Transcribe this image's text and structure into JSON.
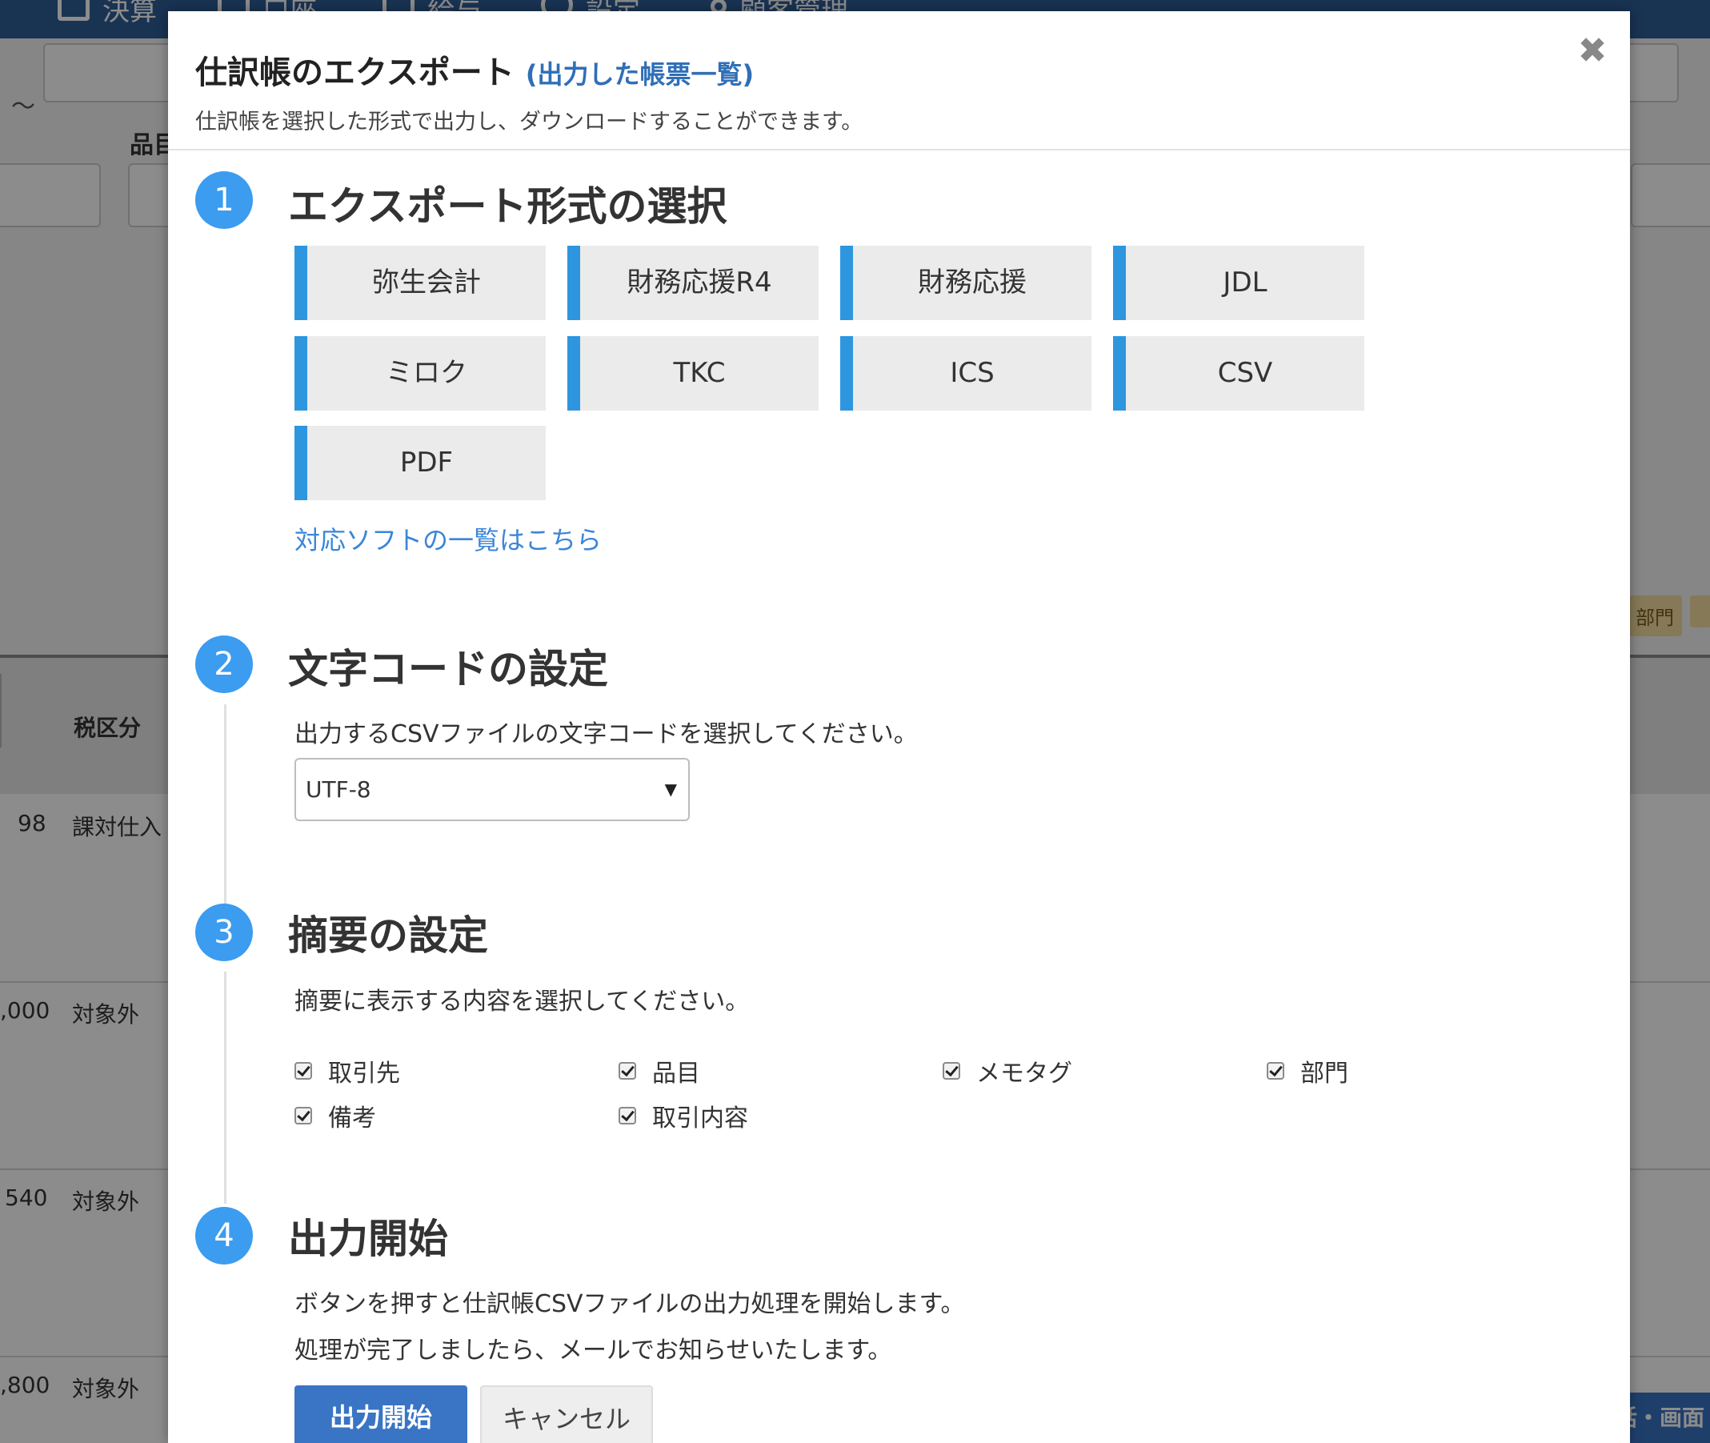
{
  "background": {
    "nav": [
      "決算",
      "口座",
      "給与",
      "設定",
      "顧客管理"
    ],
    "tilde": "〜",
    "field_label": "品目",
    "table_header": "税区分",
    "rows": [
      {
        "amount": "98",
        "tax": "課対仕入"
      },
      {
        "amount": ",000",
        "tax": "対象外"
      },
      {
        "amount": "540",
        "tax": "対象外"
      },
      {
        "amount": ",800",
        "tax": "対象外"
      }
    ],
    "tag": "部門",
    "help_text": "話・画面"
  },
  "modal": {
    "title": "仕訳帳のエクスポート",
    "title_link": "(出力した帳票一覧)",
    "description": "仕訳帳を選択した形式で出力し、ダウンロードすることができます。",
    "close_glyph": "✖"
  },
  "steps": {
    "s1": {
      "number": "1",
      "title": "エクスポート形式の選択",
      "formats": [
        "弥生会計",
        "財務応援R4",
        "財務応援",
        "JDL",
        "ミロク",
        "TKC",
        "ICS",
        "CSV",
        "PDF"
      ],
      "link": "対応ソフトの一覧はこちら"
    },
    "s2": {
      "number": "2",
      "title": "文字コードの設定",
      "text": "出力するCSVファイルの文字コードを選択してください。",
      "select_value": "UTF-8"
    },
    "s3": {
      "number": "3",
      "title": "摘要の設定",
      "text": "摘要に表示する内容を選択してください。",
      "checkboxes": [
        "取引先",
        "品目",
        "メモタグ",
        "部門",
        "備考",
        "取引内容"
      ]
    },
    "s4": {
      "number": "4",
      "title": "出力開始",
      "text1": "ボタンを押すと仕訳帳CSVファイルの出力処理を開始します。",
      "text2": "処理が完了しましたら、メールでお知らせいたします。",
      "start_button": "出力開始",
      "cancel_button": "キャンセル"
    }
  },
  "colors": {
    "accent_blue": "#2d96df",
    "step_circle": "#3b9cf0",
    "primary_button": "#3a74c4",
    "link": "#3a86d8"
  }
}
